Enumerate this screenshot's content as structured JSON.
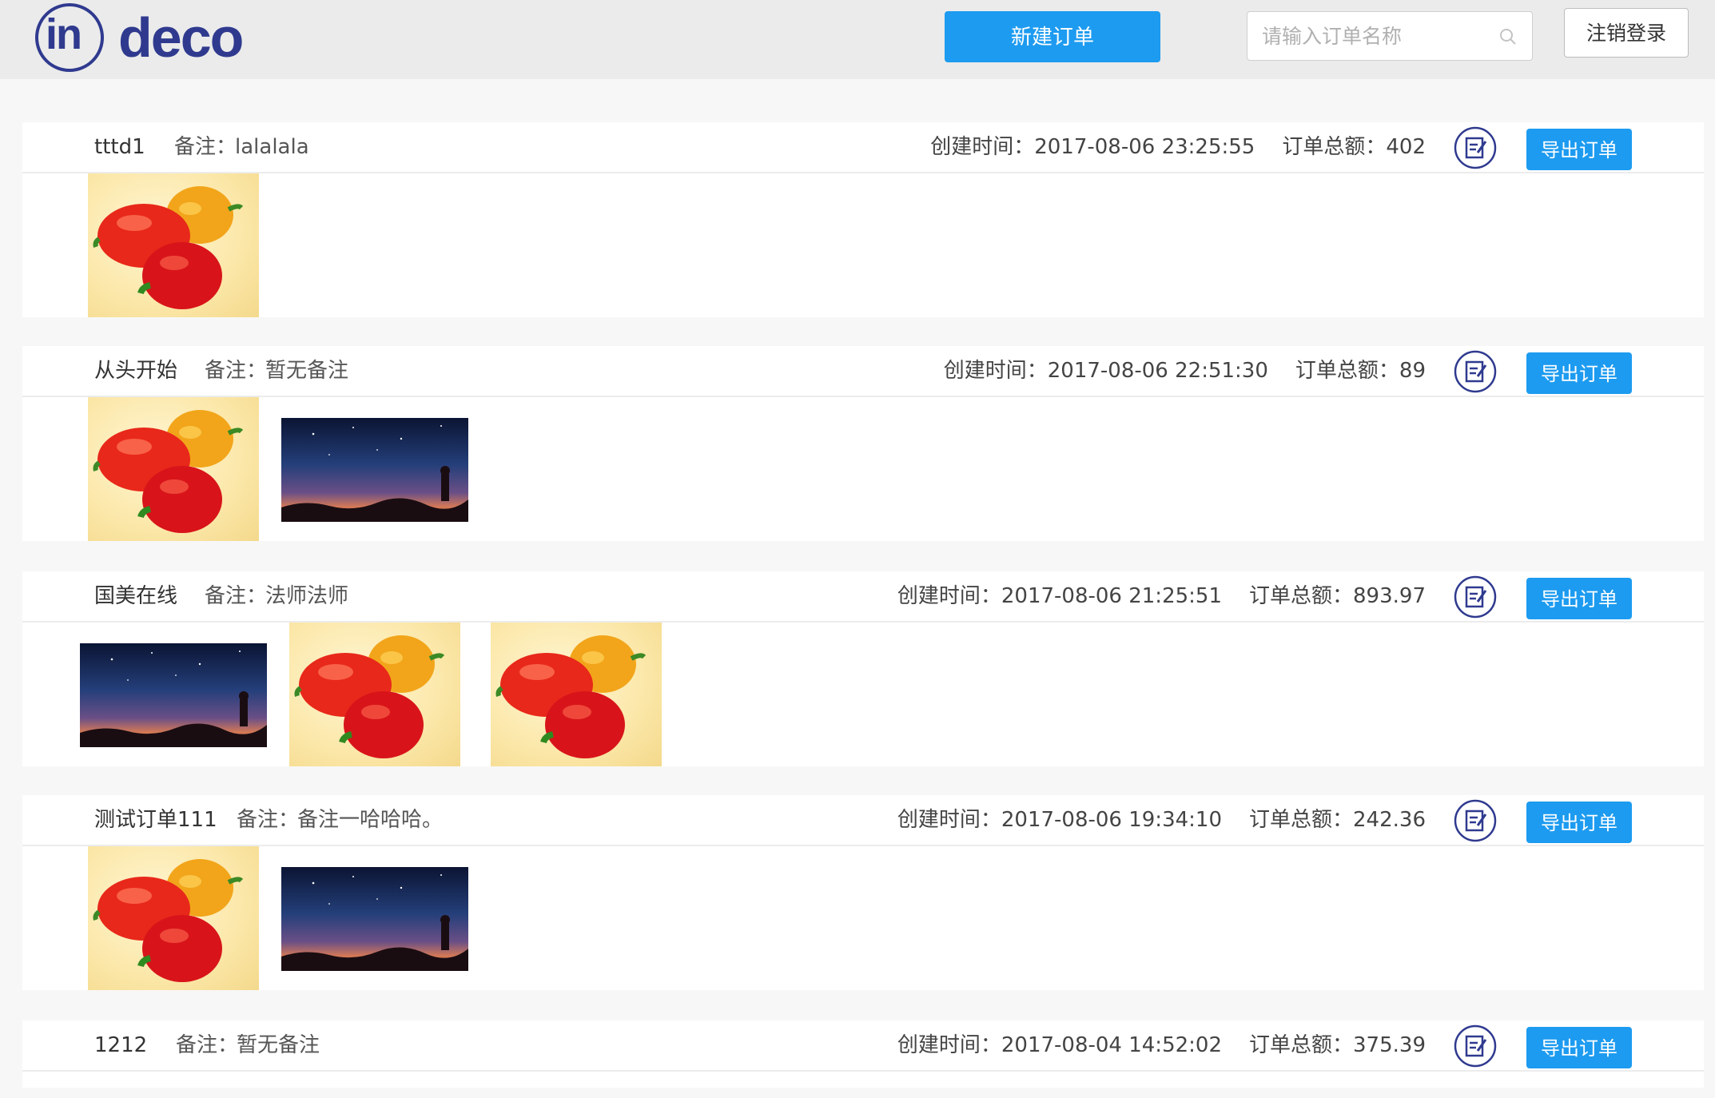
{
  "header": {
    "logo_text_in": "in",
    "logo_text_deco": "deco",
    "new_order_label": "新建订单",
    "search_placeholder": "请输入订单名称",
    "logout_label": "注销登录"
  },
  "labels": {
    "note_label": "备注：",
    "created_label": "创建时间：",
    "total_label": "订单总额：",
    "export_label": "导出订单"
  },
  "colors": {
    "accent": "#1d9bf0",
    "brand": "#2f3a8f"
  },
  "orders": [
    {
      "name": "tttd1",
      "note": "lalalala",
      "created": "2017-08-06 23:25:55",
      "total": "402",
      "thumbnails": [
        "pepper-image"
      ]
    },
    {
      "name": "从头开始",
      "note": "暂无备注",
      "created": "2017-08-06 22:51:30",
      "total": "89",
      "thumbnails": [
        "pepper-image",
        "night-sky-image"
      ]
    },
    {
      "name": "国美在线",
      "note": "法师法师",
      "created": "2017-08-06 21:25:51",
      "total": "893.97",
      "thumbnails": [
        "night-sky-image",
        "pepper-image",
        "pepper-image"
      ]
    },
    {
      "name": "测试订单111",
      "note": "备注一哈哈哈。",
      "created": "2017-08-06 19:34:10",
      "total": "242.36",
      "thumbnails": [
        "pepper-image",
        "night-sky-image"
      ]
    },
    {
      "name": "1212",
      "note": "暂无备注",
      "created": "2017-08-04 14:52:02",
      "total": "375.39",
      "thumbnails": []
    }
  ]
}
